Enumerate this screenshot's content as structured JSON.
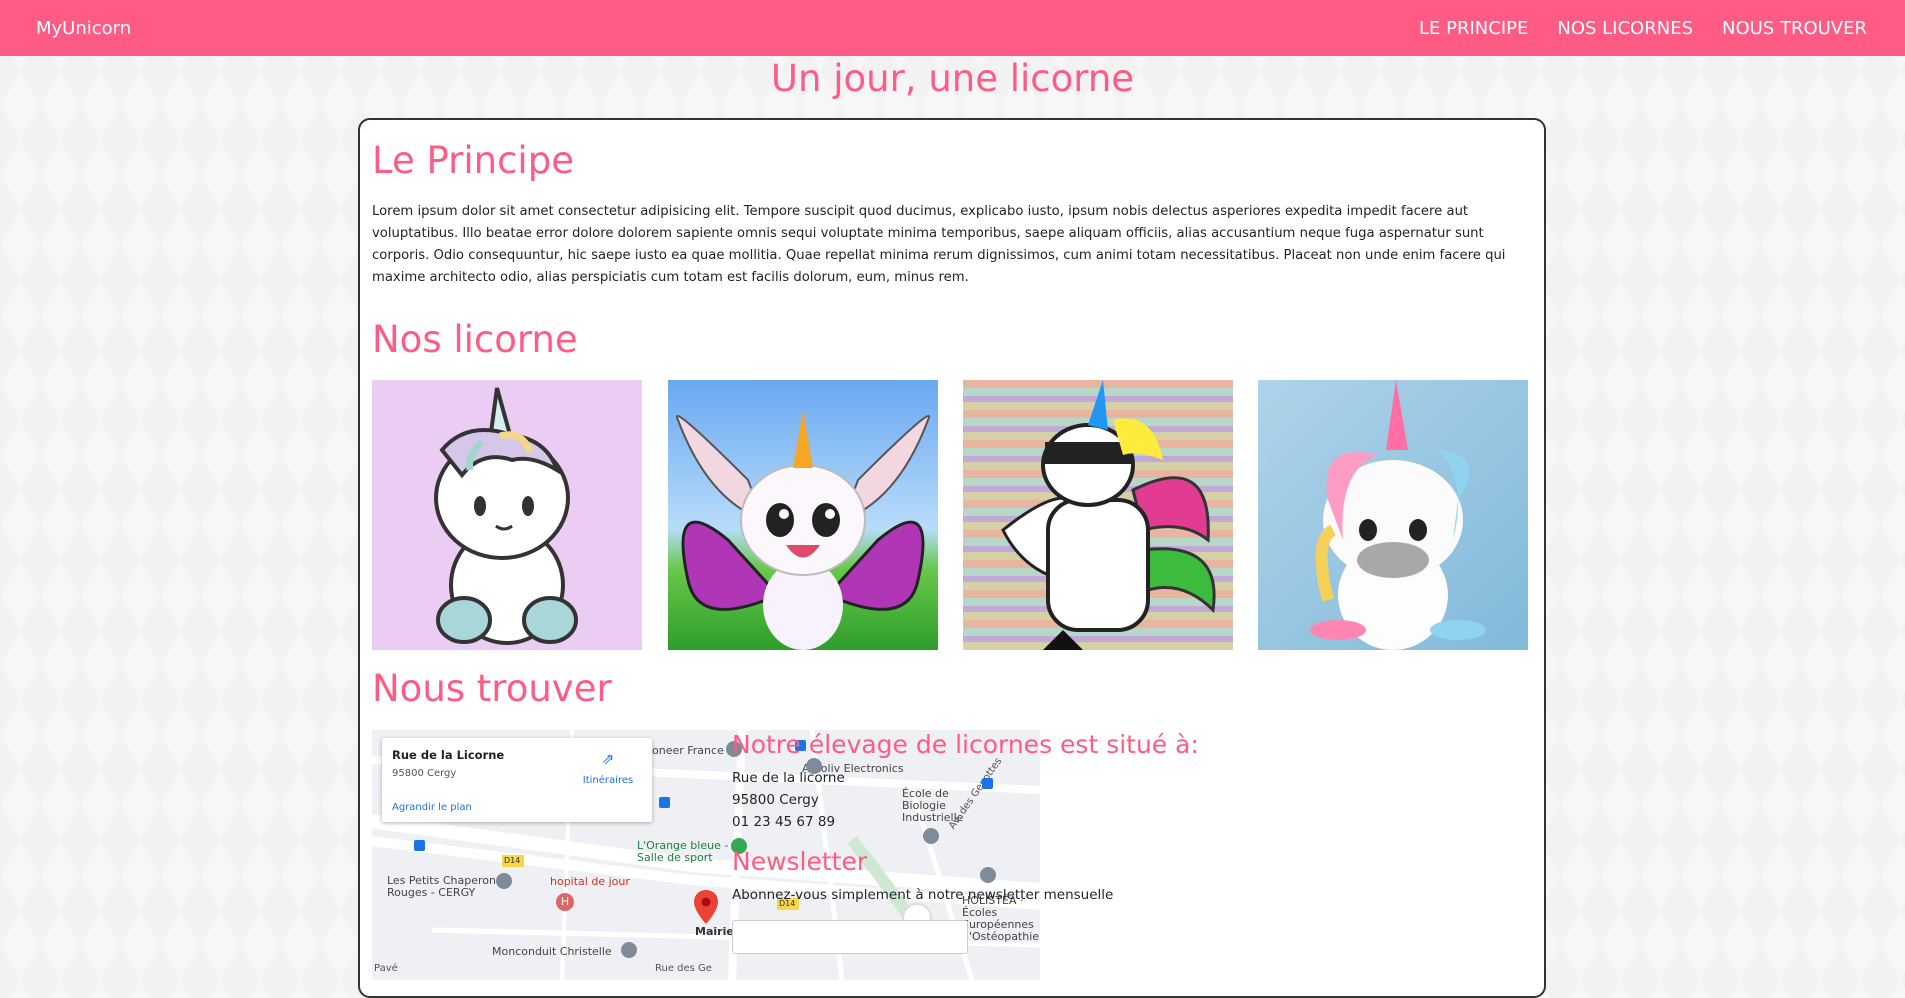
{
  "navbar": {
    "brand": "MyUnicorn",
    "links": [
      "LE PRINCIPE",
      "NOS LICORNES",
      "NOUS TROUVER"
    ]
  },
  "page_title": "Un jour, une licorne",
  "principe": {
    "heading": "Le Principe",
    "text": "Lorem ipsum dolor sit amet consectetur adipisicing elit. Tempore suscipit quod ducimus, explicabo iusto, ipsum nobis delectus asperiores expedita impedit facere aut voluptatibus. Illo beatae error dolore dolorem sapiente omnis sequi voluptate minima temporibus, saepe aliquam officiis, alias accusantium neque fuga aspernatur sunt corporis. Odio consequuntur, hic saepe iusto ea quae mollitia. Quae repellat minima rerum dignissimos, cum animi totam necessitatibus. Placeat non unde enim facere qui maxime architecto odio, alias perspiciatis cum totam est facilis dolorum, eum, minus rem."
  },
  "licornes": {
    "heading": "Nos licorne",
    "images": [
      "cute-unicorn-image",
      "butterfly-winged-unicorn-image",
      "dabbing-unicorn-image",
      "figurine-unicorn-image"
    ]
  },
  "trouver": {
    "heading": "Nous trouver",
    "map": {
      "place_title": "Rue de la Licorne",
      "place_city": "95800 Cergy",
      "directions": "Itinéraires",
      "enlarge": "Agrandir le plan",
      "labels": {
        "autoliv": "Autoliv Electronics",
        "pioneer": "oneer France",
        "ecole": "École de Biologie Industrielle",
        "orange": "L'Orange bleue - Salle de sport",
        "chaperons": "Les Petits Chaperons Rouges - CERGY",
        "hopital": "hopital de jour",
        "mairie": "Mairie de Cergy",
        "holistea": "HOLISTÉA · Écoles Européennes d'Ostéopathie",
        "monconduit": "Monconduit Christelle",
        "genottes": "Av. des Genottes",
        "d14": "D14",
        "rue_des": "Rue des Ge",
        "pave": "Pavé"
      }
    },
    "address_heading": "Notre élevage de licornes est situé à:",
    "address": [
      "Rue de la licorne",
      "95800 Cergy",
      "01 23 45 67 89"
    ],
    "newsletter_heading": "Newsletter",
    "newsletter_text": "Abonnez-vous simplement à notre newsletter mensuelle",
    "newsletter_placeholder": ""
  },
  "colors": {
    "accent": "#ff5c85",
    "text": "#212529"
  }
}
